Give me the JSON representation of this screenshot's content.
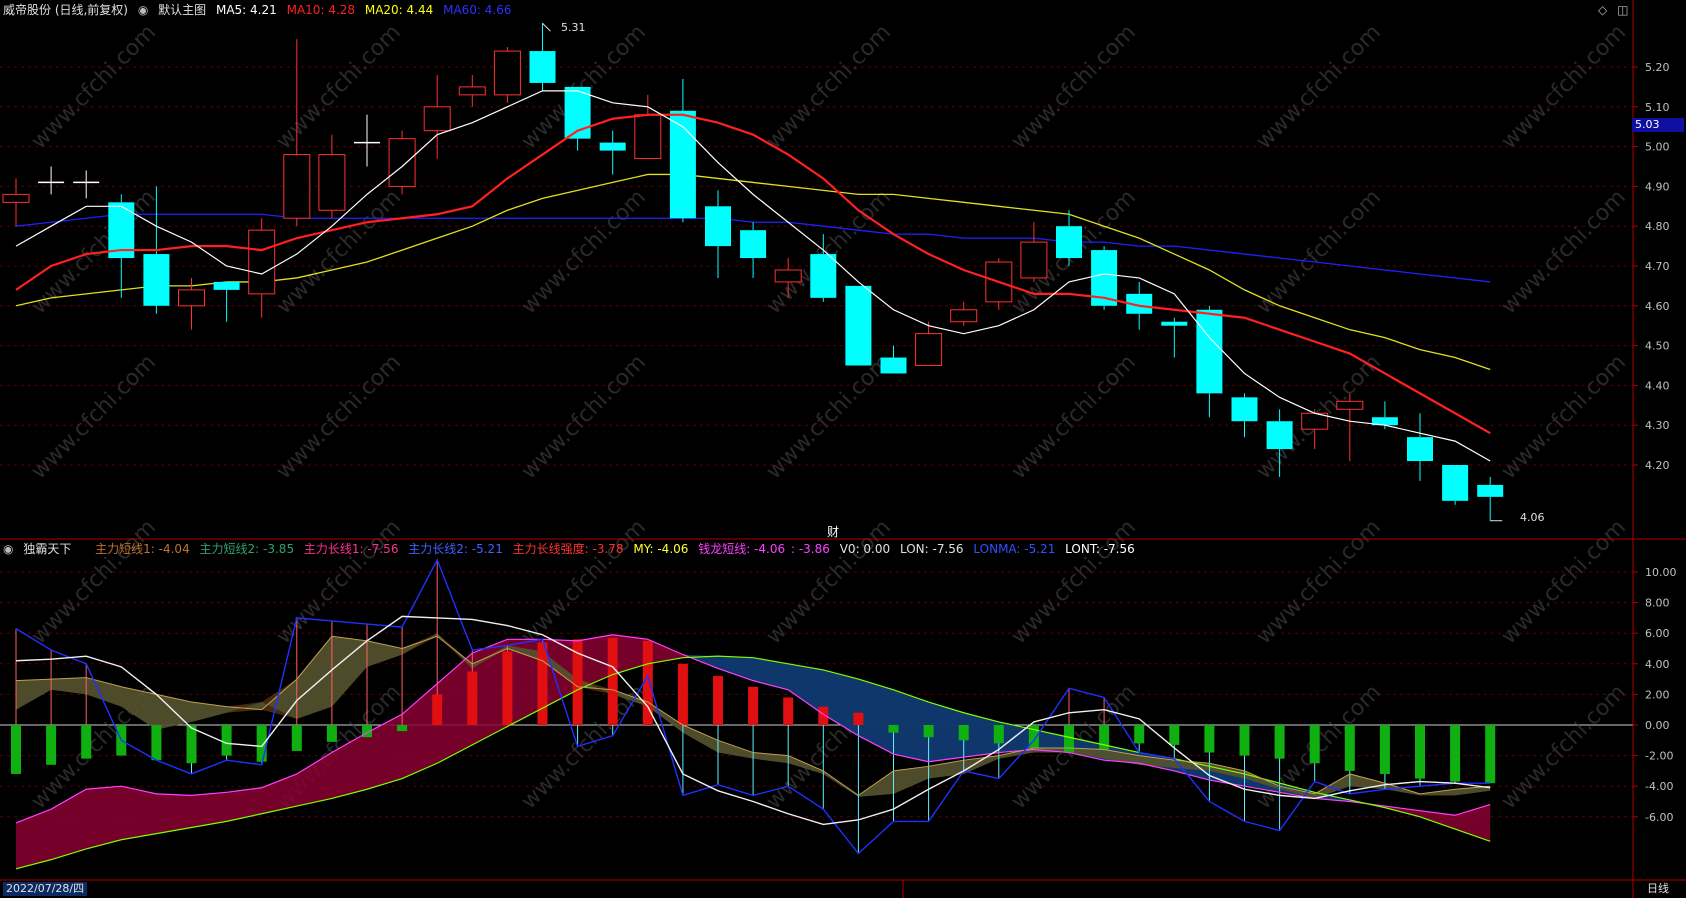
{
  "header": {
    "stock_title": "威帝股份 (日线,前复权)",
    "main_chart_label": "默认主图",
    "ma": [
      {
        "label": "MA5: 4.21",
        "color": "#ffffff"
      },
      {
        "label": "MA10: 4.28",
        "color": "#ff2020"
      },
      {
        "label": "MA20: 4.44",
        "color": "#ffff00"
      },
      {
        "label": "MA60: 4.66",
        "color": "#3030ff"
      }
    ]
  },
  "indicator_header": {
    "name": "独霸天下",
    "items": [
      {
        "label": "主力短线1: -4.04",
        "color": "#c07030"
      },
      {
        "label": "主力短线2: -3.85",
        "color": "#30a070"
      },
      {
        "label": "主力长线1: -7.56",
        "color": "#ff3090"
      },
      {
        "label": "主力长线2: -5.21",
        "color": "#4060ff"
      },
      {
        "label": "主力长线强度: -3.78",
        "color": "#ff3030"
      },
      {
        "label": "MY: -4.06",
        "color": "#ffff30"
      },
      {
        "label": "钱龙短线: -4.06",
        "color": "#ff40ff"
      },
      {
        "label": ": -3.86",
        "color": "#ff40ff"
      },
      {
        "label": "V0: 0.00",
        "color": "#e0e0e0"
      },
      {
        "label": "LON: -7.56",
        "color": "#e0e0e0"
      },
      {
        "label": "LONMA: -5.21",
        "color": "#3050ff"
      },
      {
        "label": "LONT: -7.56",
        "color": "#ffffff"
      }
    ]
  },
  "price_axis": [
    "5.20",
    "5.10",
    "5.00",
    "4.90",
    "4.80",
    "4.70",
    "4.60",
    "4.50",
    "4.40",
    "4.30",
    "4.20"
  ],
  "current_price_tag": "5.03",
  "high_marker": "5.31",
  "low_marker": "4.06",
  "fin_marker": "财",
  "indicator_axis": [
    "10.00",
    "8.00",
    "6.00",
    "4.00",
    "2.00",
    "0.00",
    "-2.00",
    "-4.00",
    "-6.00"
  ],
  "date_label": "2022/07/28/四",
  "period_label": "日线",
  "watermark": "www.cfchi.com",
  "colors": {
    "up": "#ff3030",
    "down": "#00ffff",
    "ma5": "#ffffff",
    "ma10": "#ff2020",
    "ma20": "#e0e020",
    "ma60": "#2020ff",
    "grid": "#5a0000",
    "frame": "#b00000"
  },
  "chart_data": {
    "type": "candlestick",
    "price_range": [
      4.06,
      5.31
    ],
    "candles": [
      {
        "o": 4.86,
        "c": 4.88,
        "h": 4.92,
        "l": 4.8
      },
      {
        "o": 4.91,
        "c": 4.91,
        "h": 4.95,
        "l": 4.88
      },
      {
        "o": 4.91,
        "c": 4.91,
        "h": 4.94,
        "l": 4.87
      },
      {
        "o": 4.86,
        "c": 4.72,
        "h": 4.88,
        "l": 4.62
      },
      {
        "o": 4.73,
        "c": 4.6,
        "h": 4.9,
        "l": 4.58
      },
      {
        "o": 4.6,
        "c": 4.64,
        "h": 4.67,
        "l": 4.54
      },
      {
        "o": 4.66,
        "c": 4.64,
        "h": 4.66,
        "l": 4.56
      },
      {
        "o": 4.63,
        "c": 4.79,
        "h": 4.82,
        "l": 4.57
      },
      {
        "o": 4.82,
        "c": 4.98,
        "h": 5.27,
        "l": 4.8
      },
      {
        "o": 4.84,
        "c": 4.98,
        "h": 5.03,
        "l": 4.82
      },
      {
        "o": 5.01,
        "c": 5.01,
        "h": 5.08,
        "l": 4.95
      },
      {
        "o": 4.9,
        "c": 5.02,
        "h": 5.04,
        "l": 4.88
      },
      {
        "o": 5.04,
        "c": 5.1,
        "h": 5.18,
        "l": 4.97
      },
      {
        "o": 5.13,
        "c": 5.15,
        "h": 5.18,
        "l": 5.1
      },
      {
        "o": 5.13,
        "c": 5.24,
        "h": 5.25,
        "l": 5.11
      },
      {
        "o": 5.24,
        "c": 5.16,
        "h": 5.31,
        "l": 5.14
      },
      {
        "o": 5.15,
        "c": 5.02,
        "h": 5.15,
        "l": 4.99
      },
      {
        "o": 5.01,
        "c": 4.99,
        "h": 5.04,
        "l": 4.93
      },
      {
        "o": 4.97,
        "c": 5.08,
        "h": 5.13,
        "l": 4.97
      },
      {
        "o": 5.09,
        "c": 4.82,
        "h": 5.17,
        "l": 4.81
      },
      {
        "o": 4.85,
        "c": 4.75,
        "h": 4.89,
        "l": 4.67
      },
      {
        "o": 4.79,
        "c": 4.72,
        "h": 4.81,
        "l": 4.67
      },
      {
        "o": 4.66,
        "c": 4.69,
        "h": 4.72,
        "l": 4.62
      },
      {
        "o": 4.73,
        "c": 4.62,
        "h": 4.78,
        "l": 4.61
      },
      {
        "o": 4.65,
        "c": 4.45,
        "h": 4.65,
        "l": 4.45
      },
      {
        "o": 4.47,
        "c": 4.43,
        "h": 4.5,
        "l": 4.43
      },
      {
        "o": 4.45,
        "c": 4.53,
        "h": 4.56,
        "l": 4.45
      },
      {
        "o": 4.56,
        "c": 4.59,
        "h": 4.61,
        "l": 4.55
      },
      {
        "o": 4.61,
        "c": 4.71,
        "h": 4.72,
        "l": 4.59
      },
      {
        "o": 4.67,
        "c": 4.76,
        "h": 4.81,
        "l": 4.66
      },
      {
        "o": 4.8,
        "c": 4.72,
        "h": 4.84,
        "l": 4.7
      },
      {
        "o": 4.74,
        "c": 4.6,
        "h": 4.75,
        "l": 4.59
      },
      {
        "o": 4.63,
        "c": 4.58,
        "h": 4.66,
        "l": 4.54
      },
      {
        "o": 4.56,
        "c": 4.55,
        "h": 4.57,
        "l": 4.47
      },
      {
        "o": 4.59,
        "c": 4.38,
        "h": 4.6,
        "l": 4.32
      },
      {
        "o": 4.37,
        "c": 4.31,
        "h": 4.38,
        "l": 4.27
      },
      {
        "o": 4.31,
        "c": 4.24,
        "h": 4.34,
        "l": 4.17
      },
      {
        "o": 4.29,
        "c": 4.33,
        "h": 4.34,
        "l": 4.24
      },
      {
        "o": 4.34,
        "c": 4.36,
        "h": 4.38,
        "l": 4.21
      },
      {
        "o": 4.32,
        "c": 4.3,
        "h": 4.36,
        "l": 4.29
      },
      {
        "o": 4.27,
        "c": 4.21,
        "h": 4.33,
        "l": 4.16
      },
      {
        "o": 4.2,
        "c": 4.11,
        "h": 4.2,
        "l": 4.1
      },
      {
        "o": 4.15,
        "c": 4.12,
        "h": 4.17,
        "l": 4.06
      }
    ],
    "ma5": [
      4.75,
      4.8,
      4.85,
      4.85,
      4.8,
      4.76,
      4.7,
      4.68,
      4.73,
      4.8,
      4.88,
      4.95,
      5.03,
      5.06,
      5.1,
      5.14,
      5.14,
      5.11,
      5.1,
      5.05,
      4.96,
      4.88,
      4.81,
      4.74,
      4.66,
      4.59,
      4.55,
      4.53,
      4.55,
      4.59,
      4.66,
      4.68,
      4.67,
      4.63,
      4.52,
      4.43,
      4.37,
      4.33,
      4.31,
      4.3,
      4.28,
      4.26,
      4.21
    ],
    "ma10": [
      4.64,
      4.7,
      4.73,
      4.74,
      4.74,
      4.75,
      4.75,
      4.74,
      4.77,
      4.79,
      4.81,
      4.82,
      4.83,
      4.85,
      4.92,
      4.98,
      5.04,
      5.07,
      5.08,
      5.08,
      5.06,
      5.03,
      4.98,
      4.92,
      4.84,
      4.78,
      4.73,
      4.69,
      4.66,
      4.63,
      4.63,
      4.62,
      4.6,
      4.59,
      4.58,
      4.57,
      4.54,
      4.51,
      4.48,
      4.43,
      4.38,
      4.33,
      4.28
    ],
    "ma20": [
      4.6,
      4.62,
      4.63,
      4.64,
      4.65,
      4.65,
      4.66,
      4.66,
      4.67,
      4.69,
      4.71,
      4.74,
      4.77,
      4.8,
      4.84,
      4.87,
      4.89,
      4.91,
      4.93,
      4.93,
      4.92,
      4.91,
      4.9,
      4.89,
      4.88,
      4.88,
      4.87,
      4.86,
      4.85,
      4.84,
      4.83,
      4.8,
      4.77,
      4.73,
      4.69,
      4.64,
      4.6,
      4.57,
      4.54,
      4.52,
      4.49,
      4.47,
      4.44
    ],
    "ma60": [
      4.8,
      4.81,
      4.82,
      4.83,
      4.83,
      4.83,
      4.83,
      4.83,
      4.82,
      4.82,
      4.82,
      4.82,
      4.82,
      4.82,
      4.82,
      4.82,
      4.82,
      4.82,
      4.82,
      4.82,
      4.82,
      4.81,
      4.81,
      4.8,
      4.79,
      4.78,
      4.78,
      4.77,
      4.77,
      4.77,
      4.76,
      4.76,
      4.75,
      4.75,
      4.74,
      4.73,
      4.72,
      4.71,
      4.7,
      4.69,
      4.68,
      4.67,
      4.66
    ],
    "indicator": {
      "range": [
        -8.3,
        11.2
      ],
      "bars": [
        -3.2,
        -2.6,
        -2.2,
        -2.0,
        -2.3,
        -2.5,
        -2.0,
        -2.4,
        -1.7,
        -1.1,
        -0.8,
        -0.4,
        2.0,
        3.5,
        4.8,
        5.4,
        5.6,
        5.7,
        5.5,
        4.0,
        3.2,
        2.5,
        1.8,
        1.2,
        0.8,
        -0.5,
        -0.8,
        -1.0,
        -1.2,
        -1.5,
        -1.8,
        -1.6,
        -1.2,
        -1.3,
        -1.8,
        -2.0,
        -2.2,
        -2.5,
        -3.0,
        -3.2,
        -3.5,
        -3.7,
        -3.8
      ],
      "band_top": [
        2.9,
        3.0,
        3.1,
        2.5,
        2.0,
        1.5,
        1.2,
        1.0,
        3.0,
        5.8,
        5.5,
        5.0,
        5.8,
        4.0,
        5.0,
        4.2,
        2.5,
        2.3,
        1.5,
        0.0,
        -1.0,
        -1.8,
        -2.0,
        -3.0,
        -4.6,
        -3.0,
        -2.7,
        -2.3,
        -2.0,
        -1.5,
        -1.5,
        -1.6,
        -2.0,
        -2.3,
        -2.5,
        -3.0,
        -4.0,
        -4.5,
        -3.2,
        -3.8,
        -4.5,
        -4.2,
        -4.0
      ],
      "band_bottom": [
        1.0,
        2.3,
        2.0,
        1.2,
        -0.3,
        0.2,
        0.8,
        1.5,
        0.4,
        1.2,
        3.8,
        4.6,
        6.0,
        3.7,
        5.2,
        4.8,
        3.0,
        2.0,
        1.2,
        -0.5,
        -1.8,
        -2.2,
        -2.5,
        -3.2,
        -4.7,
        -4.5,
        -3.5,
        -3.2,
        -2.2,
        -1.8,
        -1.8,
        -2.2,
        -2.6,
        -2.8,
        -3.0,
        -3.5,
        -4.2,
        -4.8,
        -4.0,
        -4.2,
        -4.6,
        -4.6,
        -4.3
      ],
      "long_top": [
        -6.4,
        -5.5,
        -4.2,
        -4.0,
        -4.5,
        -4.6,
        -4.4,
        -4.1,
        -3.2,
        -1.8,
        -0.5,
        0.7,
        2.7,
        4.7,
        5.6,
        5.6,
        5.5,
        5.9,
        5.6,
        4.6,
        3.7,
        2.9,
        2.3,
        0.7,
        -0.7,
        -1.9,
        -2.4,
        -2.1,
        -1.8,
        -1.6,
        -1.8,
        -2.3,
        -2.5,
        -3.0,
        -3.6,
        -4.0,
        -4.4,
        -4.8,
        -5.0,
        -5.3,
        -5.6,
        -5.9,
        -5.2
      ],
      "long_bottom": [
        -9.4,
        -8.8,
        -8.1,
        -7.5,
        -7.1,
        -6.7,
        -6.3,
        -5.8,
        -5.3,
        -4.8,
        -4.2,
        -3.5,
        -2.5,
        -1.3,
        -0.1,
        1.1,
        2.3,
        3.3,
        4.0,
        4.4,
        4.5,
        4.4,
        4.0,
        3.6,
        3.0,
        2.3,
        1.5,
        0.8,
        0.2,
        -0.3,
        -0.8,
        -1.3,
        -1.8,
        -2.2,
        -2.7,
        -3.2,
        -3.8,
        -4.4,
        -4.9,
        -5.4,
        -6.0,
        -6.8,
        -7.6
      ],
      "white": [
        4.2,
        4.3,
        4.5,
        3.8,
        2.0,
        -0.2,
        -1.2,
        -1.4,
        1.6,
        3.6,
        5.5,
        7.1,
        7.0,
        6.9,
        6.5,
        5.9,
        4.7,
        3.8,
        1.2,
        -3.2,
        -4.3,
        -5.0,
        -5.8,
        -6.5,
        -6.2,
        -5.5,
        -4.2,
        -3.0,
        -1.6,
        0.2,
        0.8,
        1.0,
        0.4,
        -1.5,
        -3.3,
        -4.2,
        -4.6,
        -4.8,
        -4.3,
        -3.9,
        -3.7,
        -3.8,
        -4.1
      ],
      "blue": [
        6.3,
        4.9,
        4.0,
        -1.0,
        -2.3,
        -3.2,
        -2.3,
        -2.6,
        7.0,
        6.8,
        6.6,
        6.4,
        10.8,
        4.9,
        5.2,
        5.6,
        -1.4,
        -0.7,
        3.2,
        -4.6,
        -3.9,
        -4.6,
        -4.0,
        -5.5,
        -8.4,
        -6.3,
        -6.3,
        -3.0,
        -3.5,
        -1.0,
        2.4,
        1.8,
        -1.8,
        -2.2,
        -5.0,
        -6.3,
        -6.9,
        -3.7,
        -4.5,
        -4.2,
        -4.0,
        -3.8,
        -3.8
      ]
    }
  }
}
